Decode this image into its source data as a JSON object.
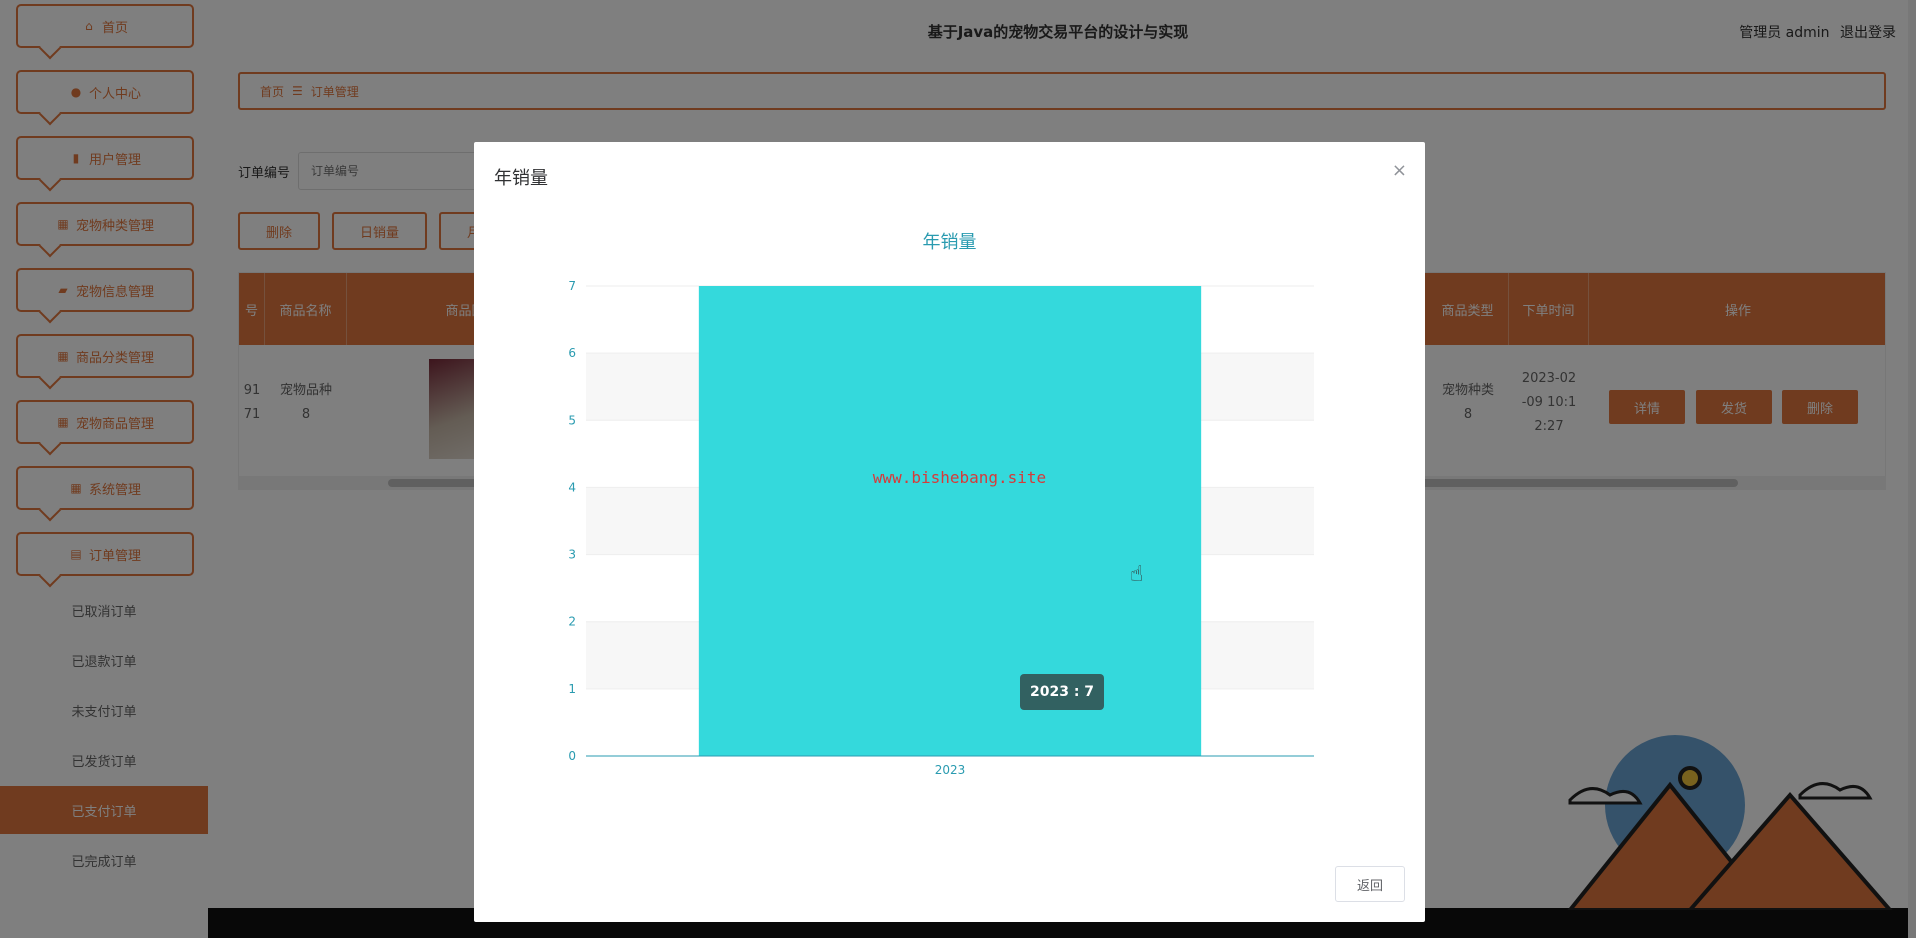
{
  "app": {
    "title": "基于Java的宠物交易平台的设计与实现",
    "user_label": "管理员 admin",
    "logout": "退出登录"
  },
  "sidebar": {
    "items": [
      {
        "label": "首页",
        "icon": "home-icon"
      },
      {
        "label": "个人中心",
        "icon": "user-icon"
      },
      {
        "label": "用户管理",
        "icon": "users-icon"
      },
      {
        "label": "宠物种类管理",
        "icon": "grid-icon"
      },
      {
        "label": "宠物信息管理",
        "icon": "folder-icon"
      },
      {
        "label": "商品分类管理",
        "icon": "grid-icon"
      },
      {
        "label": "宠物商品管理",
        "icon": "apps-icon"
      },
      {
        "label": "系统管理",
        "icon": "grid-icon"
      },
      {
        "label": "订单管理",
        "icon": "order-icon"
      }
    ],
    "subitems": [
      "已取消订单",
      "已退款订单",
      "未支付订单",
      "已发货订单",
      "已支付订单",
      "已完成订单"
    ],
    "active_subitem": "已支付订单"
  },
  "breadcrumb": {
    "home": "首页",
    "separator": "☰",
    "current": "订单管理"
  },
  "search": {
    "label": "订单编号",
    "placeholder": "订单编号"
  },
  "actions": [
    "删除",
    "日销量",
    "月"
  ],
  "table": {
    "headers": [
      "号",
      "商品名称",
      "商品图片",
      "商品类型",
      "下单时间",
      "操作"
    ],
    "row": {
      "id_partial": "91\n71",
      "name": "宠物品种\n8",
      "type": "宠物种类\n8",
      "time": "2023-02\n-09 10:1\n2:27",
      "ops": [
        "详情",
        "发货",
        "删除"
      ]
    }
  },
  "dialog": {
    "title": "年销量",
    "close": "×",
    "watermark": "www.bishebang.site",
    "tooltip": "2023 : 7",
    "footer_button": "返回"
  },
  "chart_data": {
    "type": "bar",
    "title": "年销量",
    "categories": [
      "2023"
    ],
    "values": [
      7
    ],
    "ylim": [
      0,
      7
    ],
    "yticks": [
      0,
      1,
      2,
      3,
      4,
      5,
      6,
      7
    ],
    "grid": true,
    "bar_color": "#34d9dc",
    "axis_color": "#2a9bb0"
  },
  "colors": {
    "accent": "#e0773e",
    "chart_bar": "#34d9dc",
    "chart_text": "#2a9bb0"
  }
}
